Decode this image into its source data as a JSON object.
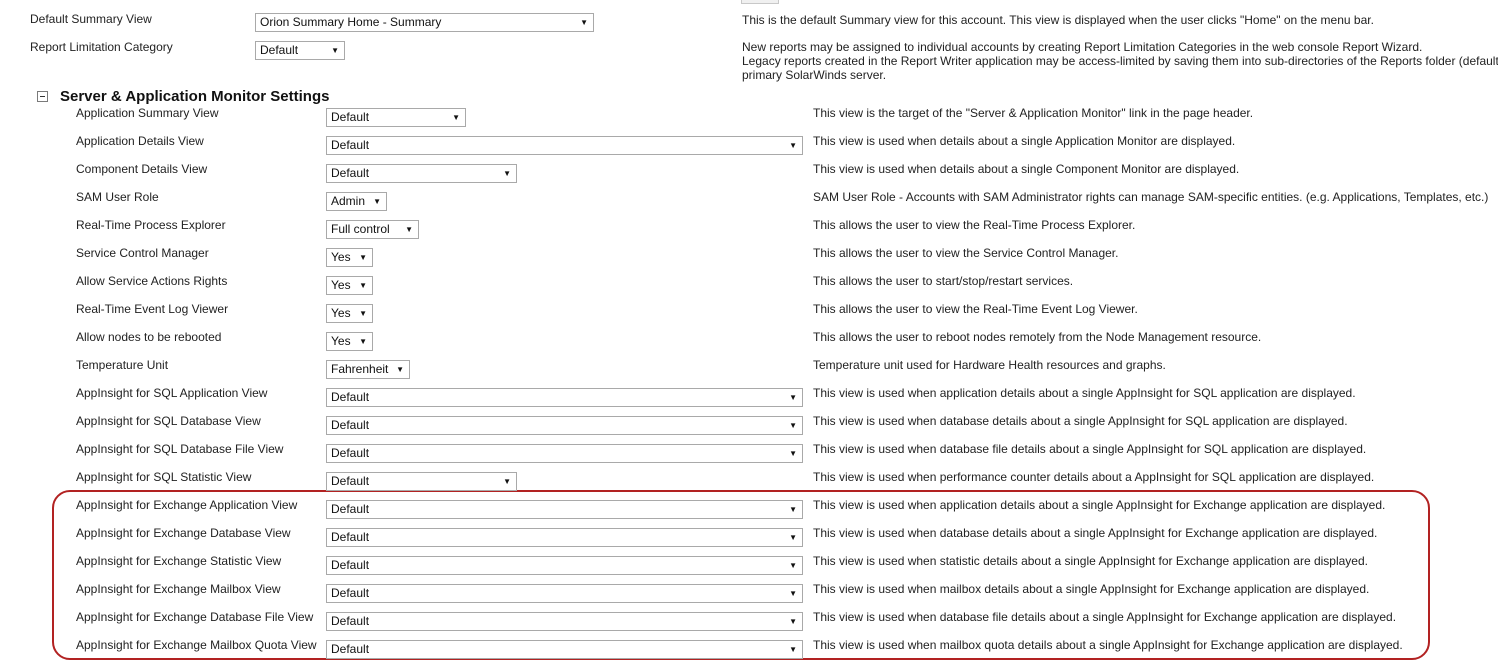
{
  "account": {
    "default_summary_view": {
      "label": "Default Summary View",
      "value": "Orion Summary Home - Summary",
      "description": "This is the default Summary view for this account. This view is displayed when the user clicks \"Home\" on the menu bar."
    },
    "report_limitation_category": {
      "label": "Report Limitation Category",
      "value": "Default",
      "description_line1": "New reports may be assigned to individual accounts by creating Report Limitation Categories in the web console Report Wizard.",
      "description_line2": "Legacy reports created in the Report Writer application may be access-limited by saving them into sub-directories of the Reports folder (default",
      "description_line3": "primary SolarWinds server."
    }
  },
  "section": {
    "title": "Server & Application Monitor Settings",
    "rows": [
      {
        "label": "Application Summary View",
        "value": "Default",
        "description": "This view is the target of the \"Server & Application Monitor\" link in the page header."
      },
      {
        "label": "Application Details View",
        "value": "Default",
        "description": "This view is used when details about a single Application Monitor are displayed."
      },
      {
        "label": "Component Details View",
        "value": "Default",
        "description": "This view is used when details about a single Component Monitor are displayed."
      },
      {
        "label": "SAM User Role",
        "value": "Admin",
        "description": "SAM User Role - Accounts with SAM Administrator rights can manage SAM-specific entities. (e.g. Applications, Templates, etc.)"
      },
      {
        "label": "Real-Time Process Explorer",
        "value": "Full control",
        "description": "This allows the user to view the Real-Time Process Explorer."
      },
      {
        "label": "Service Control Manager",
        "value": "Yes",
        "description": "This allows the user to view the Service Control Manager."
      },
      {
        "label": "Allow Service Actions Rights",
        "value": "Yes",
        "description": "This allows the user to start/stop/restart services."
      },
      {
        "label": "Real-Time Event Log Viewer",
        "value": "Yes",
        "description": "This allows the user to view the Real-Time Event Log Viewer."
      },
      {
        "label": "Allow nodes to be rebooted",
        "value": "Yes",
        "description": "This allows the user to reboot nodes remotely from the Node Management resource."
      },
      {
        "label": "Temperature Unit",
        "value": "Fahrenheit",
        "description": "Temperature unit used for Hardware Health resources and graphs."
      },
      {
        "label": "AppInsight for SQL Application View",
        "value": "Default",
        "description": "This view is used when application details about a single AppInsight for SQL application are displayed."
      },
      {
        "label": "AppInsight for SQL Database View",
        "value": "Default",
        "description": "This view is used when database details about a single AppInsight for SQL application are displayed."
      },
      {
        "label": "AppInsight for SQL Database File View",
        "value": "Default",
        "description": "This view is used when database file details about a single AppInsight for SQL application are displayed."
      },
      {
        "label": "AppInsight for SQL Statistic View",
        "value": "Default",
        "description": "This view is used when performance counter details about a AppInsight for SQL application are displayed."
      },
      {
        "label": "AppInsight for Exchange Application View",
        "value": "Default",
        "description": "This view is used when application details about a single AppInsight for Exchange application are displayed."
      },
      {
        "label": "AppInsight for Exchange Database View",
        "value": "Default",
        "description": "This view is used when database details about a single AppInsight for Exchange application are displayed."
      },
      {
        "label": "AppInsight for Exchange Statistic View",
        "value": "Default",
        "description": "This view is used when statistic details about a single AppInsight for Exchange application are displayed."
      },
      {
        "label": "AppInsight for Exchange Mailbox View",
        "value": "Default",
        "description": "This view is used when mailbox details about a single AppInsight for Exchange application are displayed."
      },
      {
        "label": "AppInsight for Exchange Database File View",
        "value": "Default",
        "description": "This view is used when database file details about a single AppInsight for Exchange application are displayed."
      },
      {
        "label": "AppInsight for Exchange Mailbox Quota View",
        "value": "Default",
        "description": "This view is used when mailbox quota details about a single AppInsight for Exchange application are displayed."
      }
    ]
  },
  "icons": {
    "collapse": "minus-box-icon",
    "dropdown": "chevron-down-icon"
  },
  "colors": {
    "highlight_border": "#b22222"
  }
}
